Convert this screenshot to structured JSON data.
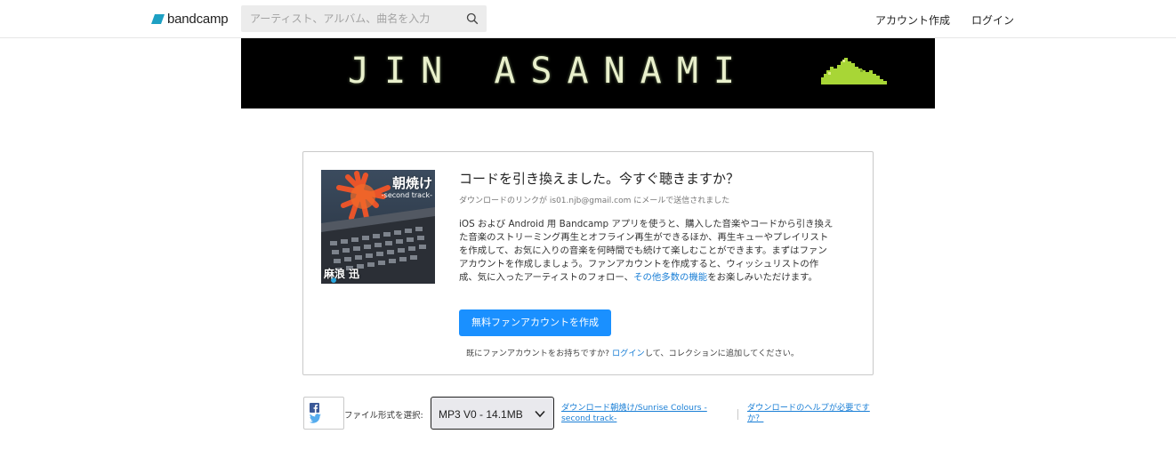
{
  "header": {
    "logo_text": "bandcamp",
    "search_placeholder": "アーティスト、アルバム、曲名を入力",
    "nav": {
      "signup": "アカウント作成",
      "login": "ログイン"
    }
  },
  "banner": {
    "title": "JIN ASANAMI"
  },
  "cover": {
    "title": "朝焼け",
    "subtitle": "-second track-",
    "artist": "麻浪 迅"
  },
  "card": {
    "headline": "コードを引き換えました。今すぐ聴きますか？",
    "sent_note_prefix": "ダウンロードのリンクが ",
    "sent_email": "is01.njb@gmail.com",
    "sent_note_suffix": " にメールで送信されました",
    "description": "iOS および Android 用 Bandcamp アプリを使うと、購入した音楽やコードから引き換えた音楽のストリーミング再生とオフライン再生ができるほか、再生キューやプレイリストを作成して、お気に入りの音楽を何時間でも続けて楽しむことができます。まずはファンアカウントを作成しましょう。ファンアカウントを作成すると、ウィッシュリストの作成、気に入ったアーティストのフォロー、",
    "features_link": "その他多数の機能",
    "description_end": "をお楽しみいただけます。",
    "cta_label": "無料ファンアカウントを作成",
    "login_prefix": "既にファンアカウントをお持ちですか? ",
    "login_link": "ログイン",
    "login_suffix": "して、コレクションに追加してください。"
  },
  "download": {
    "format_label": "ファイル形式を選択:",
    "format_selected": "MP3 V0 - 14.1MB",
    "download_link": "ダウンロード朝焼け/Sunrise Colours - second track-",
    "help_link": "ダウンロードのヘルプが必要ですか？"
  },
  "colors": {
    "accent": "#1a90ff",
    "link": "#1a7fd6",
    "banner_bg": "#000000",
    "mountain": "#a8d636"
  },
  "icons": [
    "bandcamp-logo-icon",
    "search-icon",
    "mountain-icon",
    "facebook-icon",
    "twitter-icon",
    "chevron-down-icon"
  ]
}
